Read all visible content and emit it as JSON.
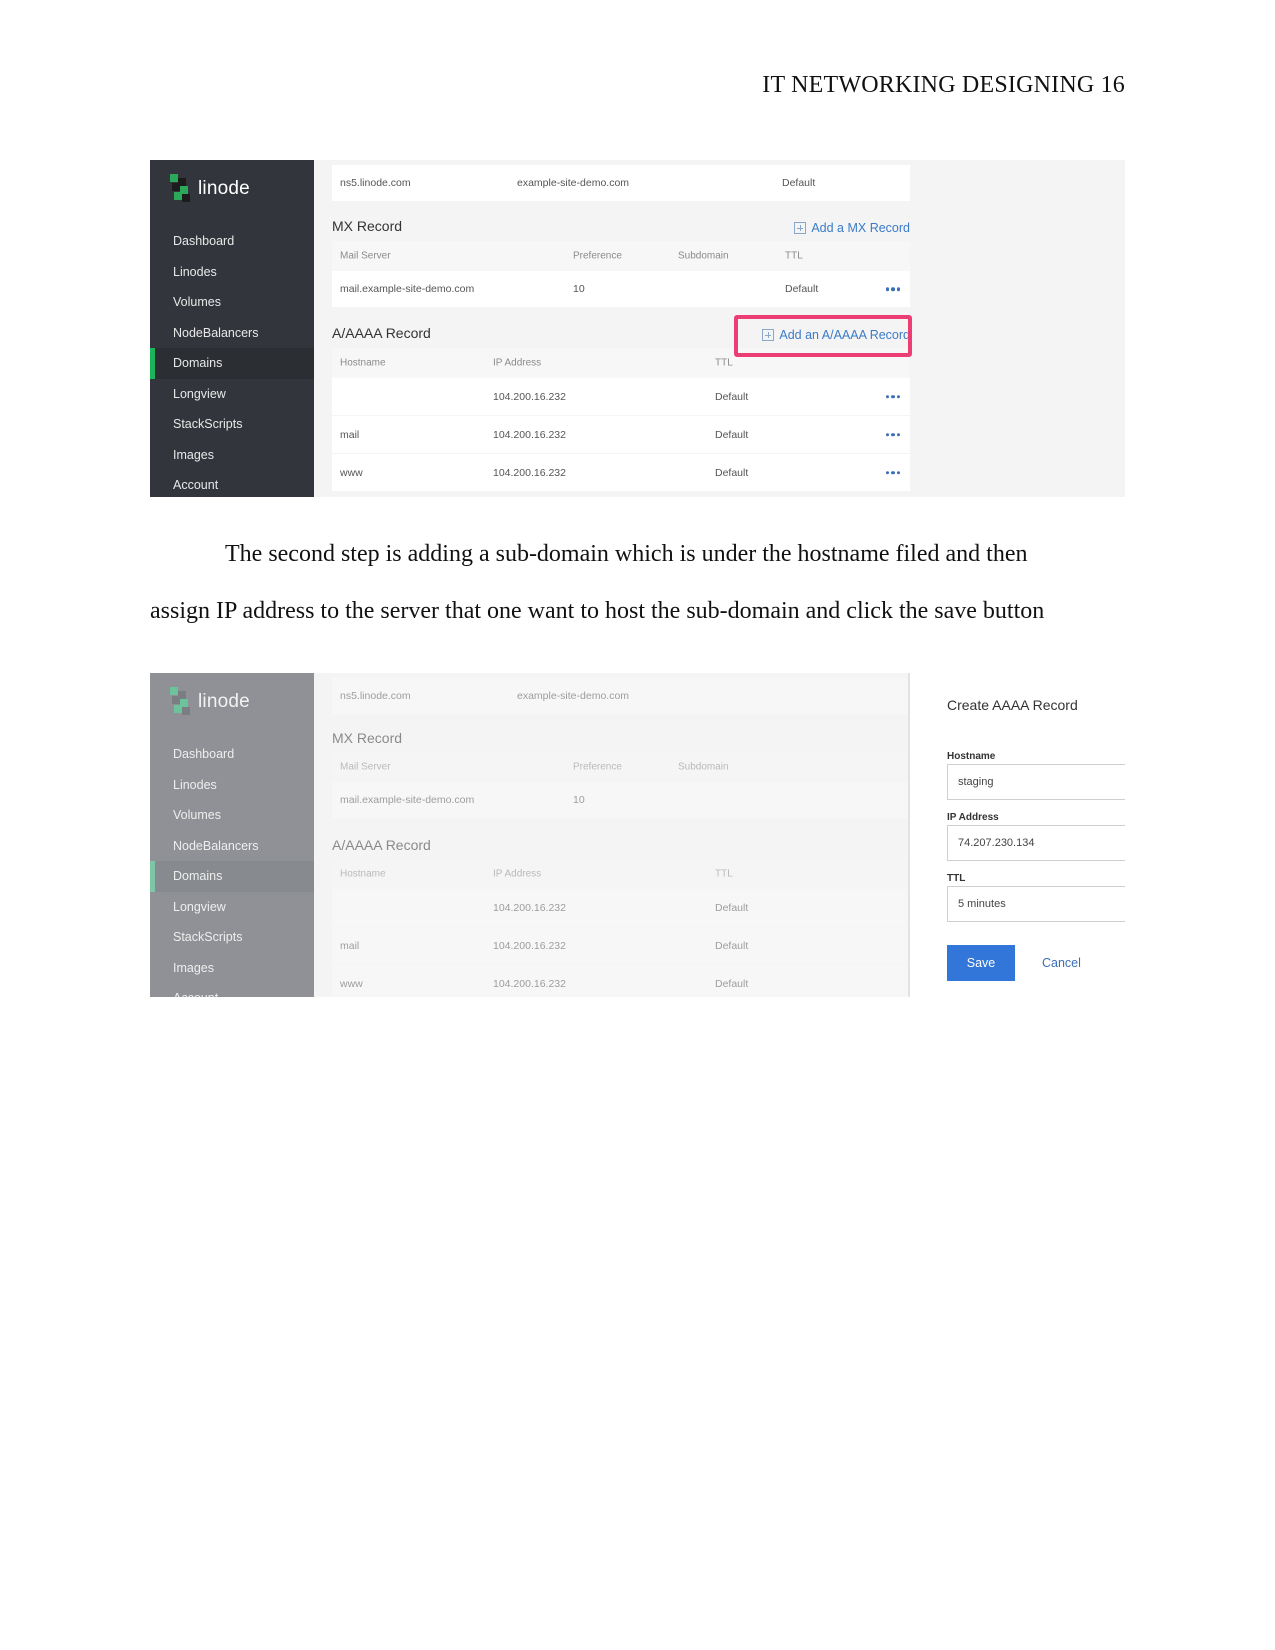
{
  "document": {
    "running_head": "IT NETWORKING DESIGNING 16",
    "paragraph_lines": [
      "The second step is adding a sub-domain which is under the hostname filed and then",
      "assign IP address to the server that one want to host the sub-domain and click the save button"
    ]
  },
  "app": {
    "logo_text": "linode",
    "nav": [
      "Dashboard",
      "Linodes",
      "Volumes",
      "NodeBalancers",
      "Domains",
      "Longview",
      "StackScripts",
      "Images",
      "Account"
    ],
    "active_nav": "Domains",
    "ns_row": {
      "nameserver": "ns5.linode.com",
      "subdomain": "example-site-demo.com",
      "ttl": "Default"
    },
    "mx": {
      "title": "MX Record",
      "add_label": "Add a MX Record",
      "headers": [
        "Mail Server",
        "Preference",
        "Subdomain",
        "TTL"
      ],
      "rows": [
        {
          "mail_server": "mail.example-site-demo.com",
          "preference": "10",
          "subdomain": "",
          "ttl": "Default"
        }
      ]
    },
    "a_record": {
      "title": "A/AAAA Record",
      "add_label": "Add an A/AAAA Record",
      "headers": [
        "Hostname",
        "IP Address",
        "TTL"
      ],
      "rows": [
        {
          "hostname": "",
          "ip": "104.200.16.232",
          "ttl": "Default"
        },
        {
          "hostname": "mail",
          "ip": "104.200.16.232",
          "ttl": "Default"
        },
        {
          "hostname": "www",
          "ip": "104.200.16.232",
          "ttl": "Default"
        }
      ]
    },
    "colors": {
      "accent": "#3176d8",
      "highlight": "#ec3d75",
      "sidebar": "#32363c",
      "active_bar": "#1bb45a"
    }
  },
  "modal": {
    "title": "Create AAAA Record",
    "close_icon": "close-icon",
    "hostname_label": "Hostname",
    "hostname_value": "staging",
    "ip_label": "IP Address",
    "ip_value": "74.207.230.134",
    "ttl_label": "TTL",
    "ttl_value": "5 minutes",
    "save_label": "Save",
    "cancel_label": "Cancel"
  }
}
